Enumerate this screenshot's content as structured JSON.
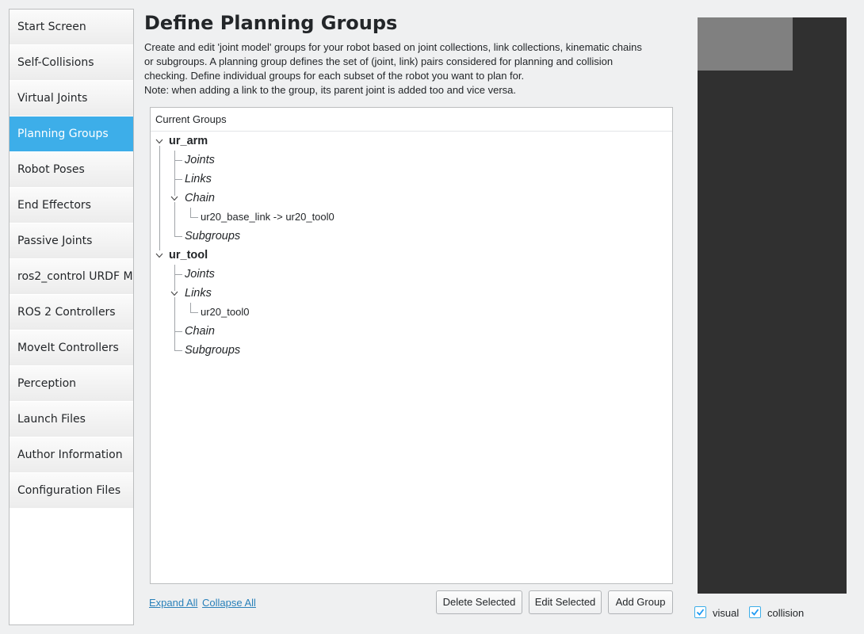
{
  "sidebar": {
    "items": [
      {
        "label": "Start Screen",
        "active": false
      },
      {
        "label": "Self-Collisions",
        "active": false
      },
      {
        "label": "Virtual Joints",
        "active": false
      },
      {
        "label": "Planning Groups",
        "active": true
      },
      {
        "label": "Robot Poses",
        "active": false
      },
      {
        "label": "End Effectors",
        "active": false
      },
      {
        "label": "Passive Joints",
        "active": false
      },
      {
        "label": "ros2_control URDF Mo",
        "active": false
      },
      {
        "label": "ROS 2 Controllers",
        "active": false
      },
      {
        "label": "MoveIt Controllers",
        "active": false
      },
      {
        "label": "Perception",
        "active": false
      },
      {
        "label": "Launch Files",
        "active": false
      },
      {
        "label": "Author Information",
        "active": false
      },
      {
        "label": "Configuration Files",
        "active": false
      }
    ]
  },
  "main": {
    "title": "Define Planning Groups",
    "description": [
      "Create and edit 'joint model' groups for your robot based on joint collections, link collections, kinematic chains",
      "or subgroups. A planning group defines the set of (joint, link) pairs considered for planning and collision",
      "checking. Define individual groups for each subset of the robot you want to plan for.",
      "Note: when adding a link to the group, its parent joint is added too and vice versa."
    ]
  },
  "tree": {
    "header": "Current Groups",
    "groups": [
      {
        "name": "ur_arm",
        "children": [
          {
            "label": "Joints",
            "items": []
          },
          {
            "label": "Links",
            "items": []
          },
          {
            "label": "Chain",
            "items": [
              "ur20_base_link  ->  ur20_tool0"
            ]
          },
          {
            "label": "Subgroups",
            "items": []
          }
        ]
      },
      {
        "name": "ur_tool",
        "children": [
          {
            "label": "Joints",
            "items": []
          },
          {
            "label": "Links",
            "items": [
              "ur20_tool0"
            ]
          },
          {
            "label": "Chain",
            "items": []
          },
          {
            "label": "Subgroups",
            "items": []
          }
        ]
      }
    ]
  },
  "actions": {
    "expand_all": "Expand All",
    "collapse_all": "Collapse All",
    "delete_selected": "Delete Selected",
    "edit_selected": "Edit Selected",
    "add_group": "Add Group"
  },
  "viewer": {
    "visual_label": "visual",
    "visual_checked": true,
    "collision_label": "collision",
    "collision_checked": true
  },
  "colors": {
    "accent": "#3daee9",
    "link": "#2980b9",
    "viewer_bg": "#303030"
  }
}
